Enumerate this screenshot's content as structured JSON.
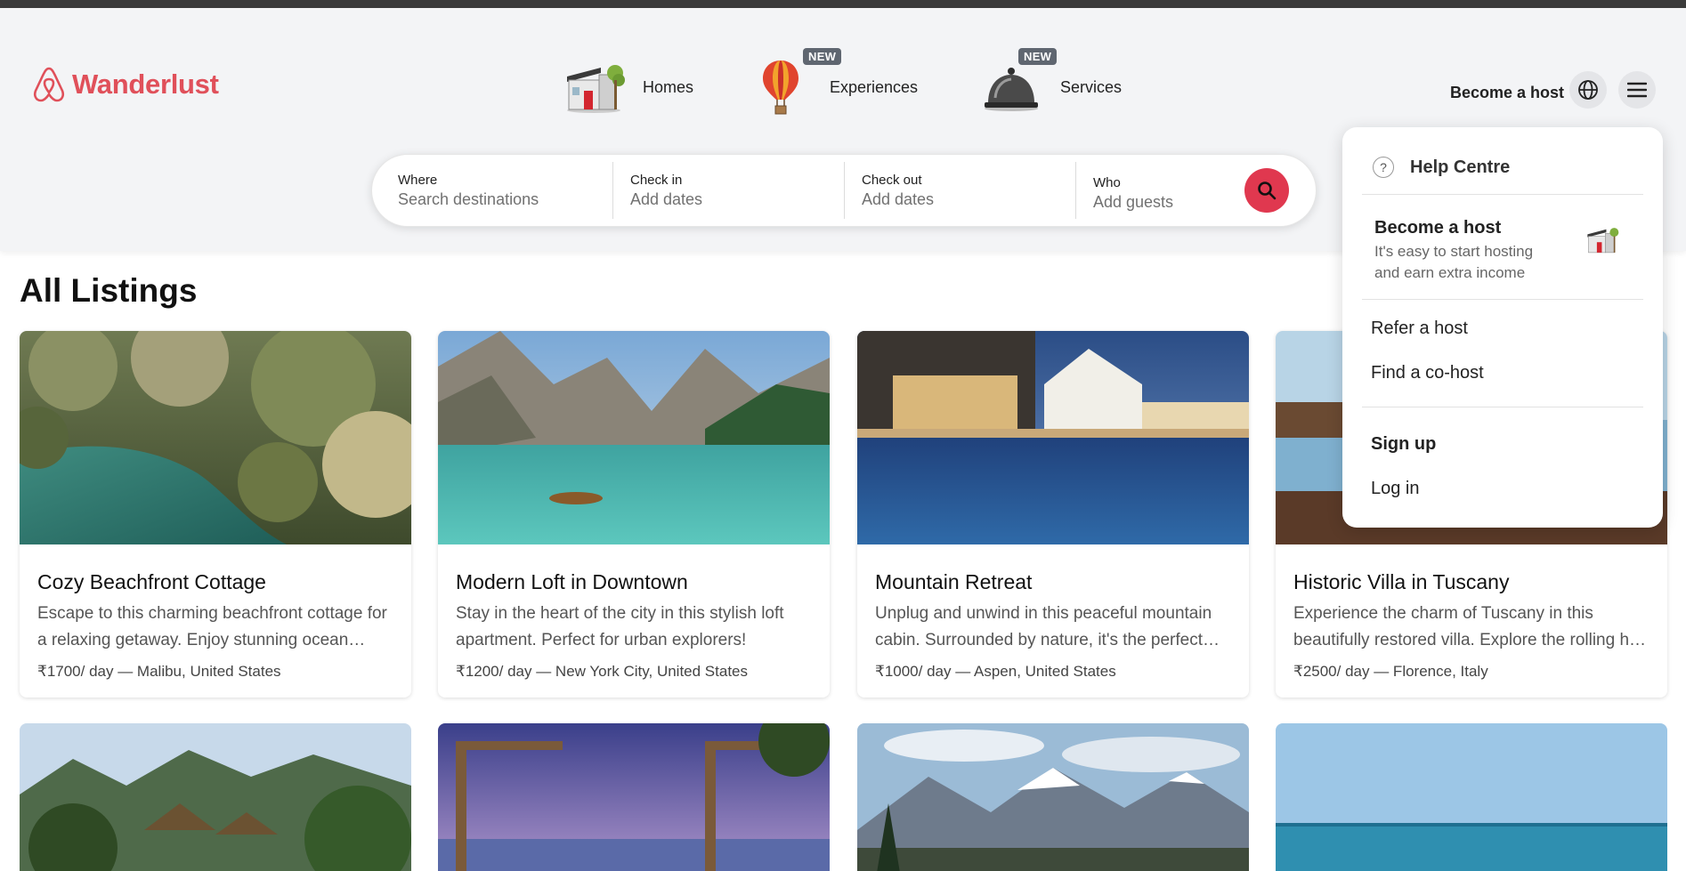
{
  "brand": {
    "name": "Wanderlust",
    "color": "#e0505a"
  },
  "nav": {
    "categories": [
      {
        "label": "Homes",
        "icon": "house-icon",
        "badge": ""
      },
      {
        "label": "Experiences",
        "icon": "hot-air-balloon-icon",
        "badge": "NEW"
      },
      {
        "label": "Services",
        "icon": "service-bell-icon",
        "badge": "NEW"
      }
    ],
    "become_host": "Become a host",
    "globe_icon": "globe-icon",
    "menu_icon": "hamburger-menu-icon"
  },
  "search": {
    "where": {
      "label": "Where",
      "placeholder": "Search destinations"
    },
    "checkin": {
      "label": "Check in",
      "value": "Add dates"
    },
    "checkout": {
      "label": "Check out",
      "value": "Add dates"
    },
    "who": {
      "label": "Who",
      "value": "Add guests"
    },
    "button_icon": "search-icon",
    "accent": "#e0384f"
  },
  "main": {
    "title": "All Listings",
    "listings": [
      {
        "title": "Cozy Beachfront Cottage",
        "description": "Escape to this charming beachfront cottage for a relaxing getaway. Enjoy stunning ocean views and easy access to the beach.",
        "price": "₹1700/ day — Malibu, United States"
      },
      {
        "title": "Modern Loft in Downtown",
        "description": "Stay in the heart of the city in this stylish loft apartment. Perfect for urban explorers!",
        "price": "₹1200/ day — New York City, United States"
      },
      {
        "title": "Mountain Retreat",
        "description": "Unplug and unwind in this peaceful mountain cabin. Surrounded by nature, it's the perfect place to recharge.",
        "price": "₹1000/ day — Aspen, United States"
      },
      {
        "title": "Historic Villa in Tuscany",
        "description": "Experience the charm of Tuscany in this beautifully restored villa. Explore the rolling hills and vineyards.",
        "price": "₹2500/ day — Florence, Italy"
      }
    ]
  },
  "dropdown": {
    "help": "Help Centre",
    "host_title": "Become a host",
    "host_subtitle_1": "It's easy to start hosting",
    "host_subtitle_2": "and earn extra income",
    "refer": "Refer a host",
    "cohost": "Find a co-host",
    "signup": "Sign up",
    "login": "Log in"
  }
}
